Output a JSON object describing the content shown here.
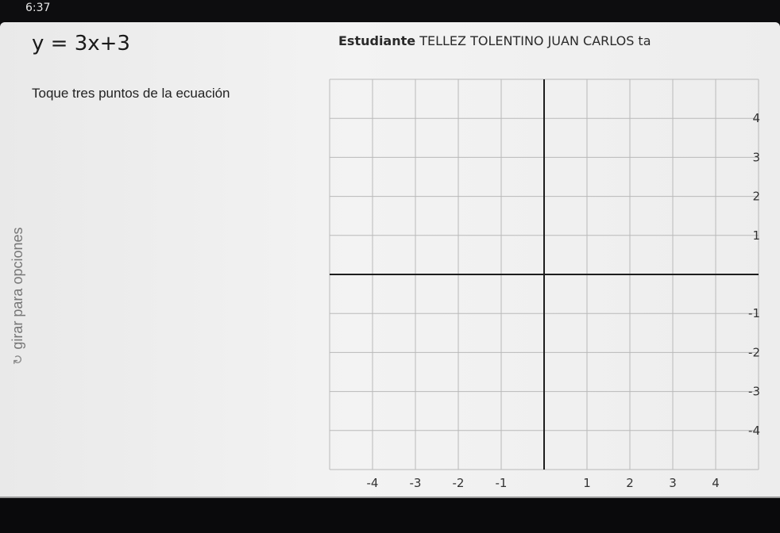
{
  "status": {
    "time": "6:37"
  },
  "problem": {
    "equation": "y = 3x+3",
    "student_label": "Estudiante",
    "student_name": "TELLEZ TOLENTINO JUAN CARLOS ta",
    "instruction": "Toque tres puntos de la ecuación"
  },
  "rotate": {
    "icon": "rotate-icon",
    "text": "girar para opciones"
  },
  "graph": {
    "x_ticks": [
      "-4",
      "-3",
      "-2",
      "-1",
      "1",
      "2",
      "3",
      "4"
    ],
    "y_ticks": [
      "4",
      "3",
      "2",
      "1",
      "-1",
      "-2",
      "-3",
      "-4"
    ],
    "x_range": [
      -5,
      5
    ],
    "y_range": [
      -5,
      5
    ],
    "grid": true,
    "colors": {
      "grid": "#b9b9b9",
      "axis": "#1e1e1e",
      "label": "#333333"
    }
  }
}
